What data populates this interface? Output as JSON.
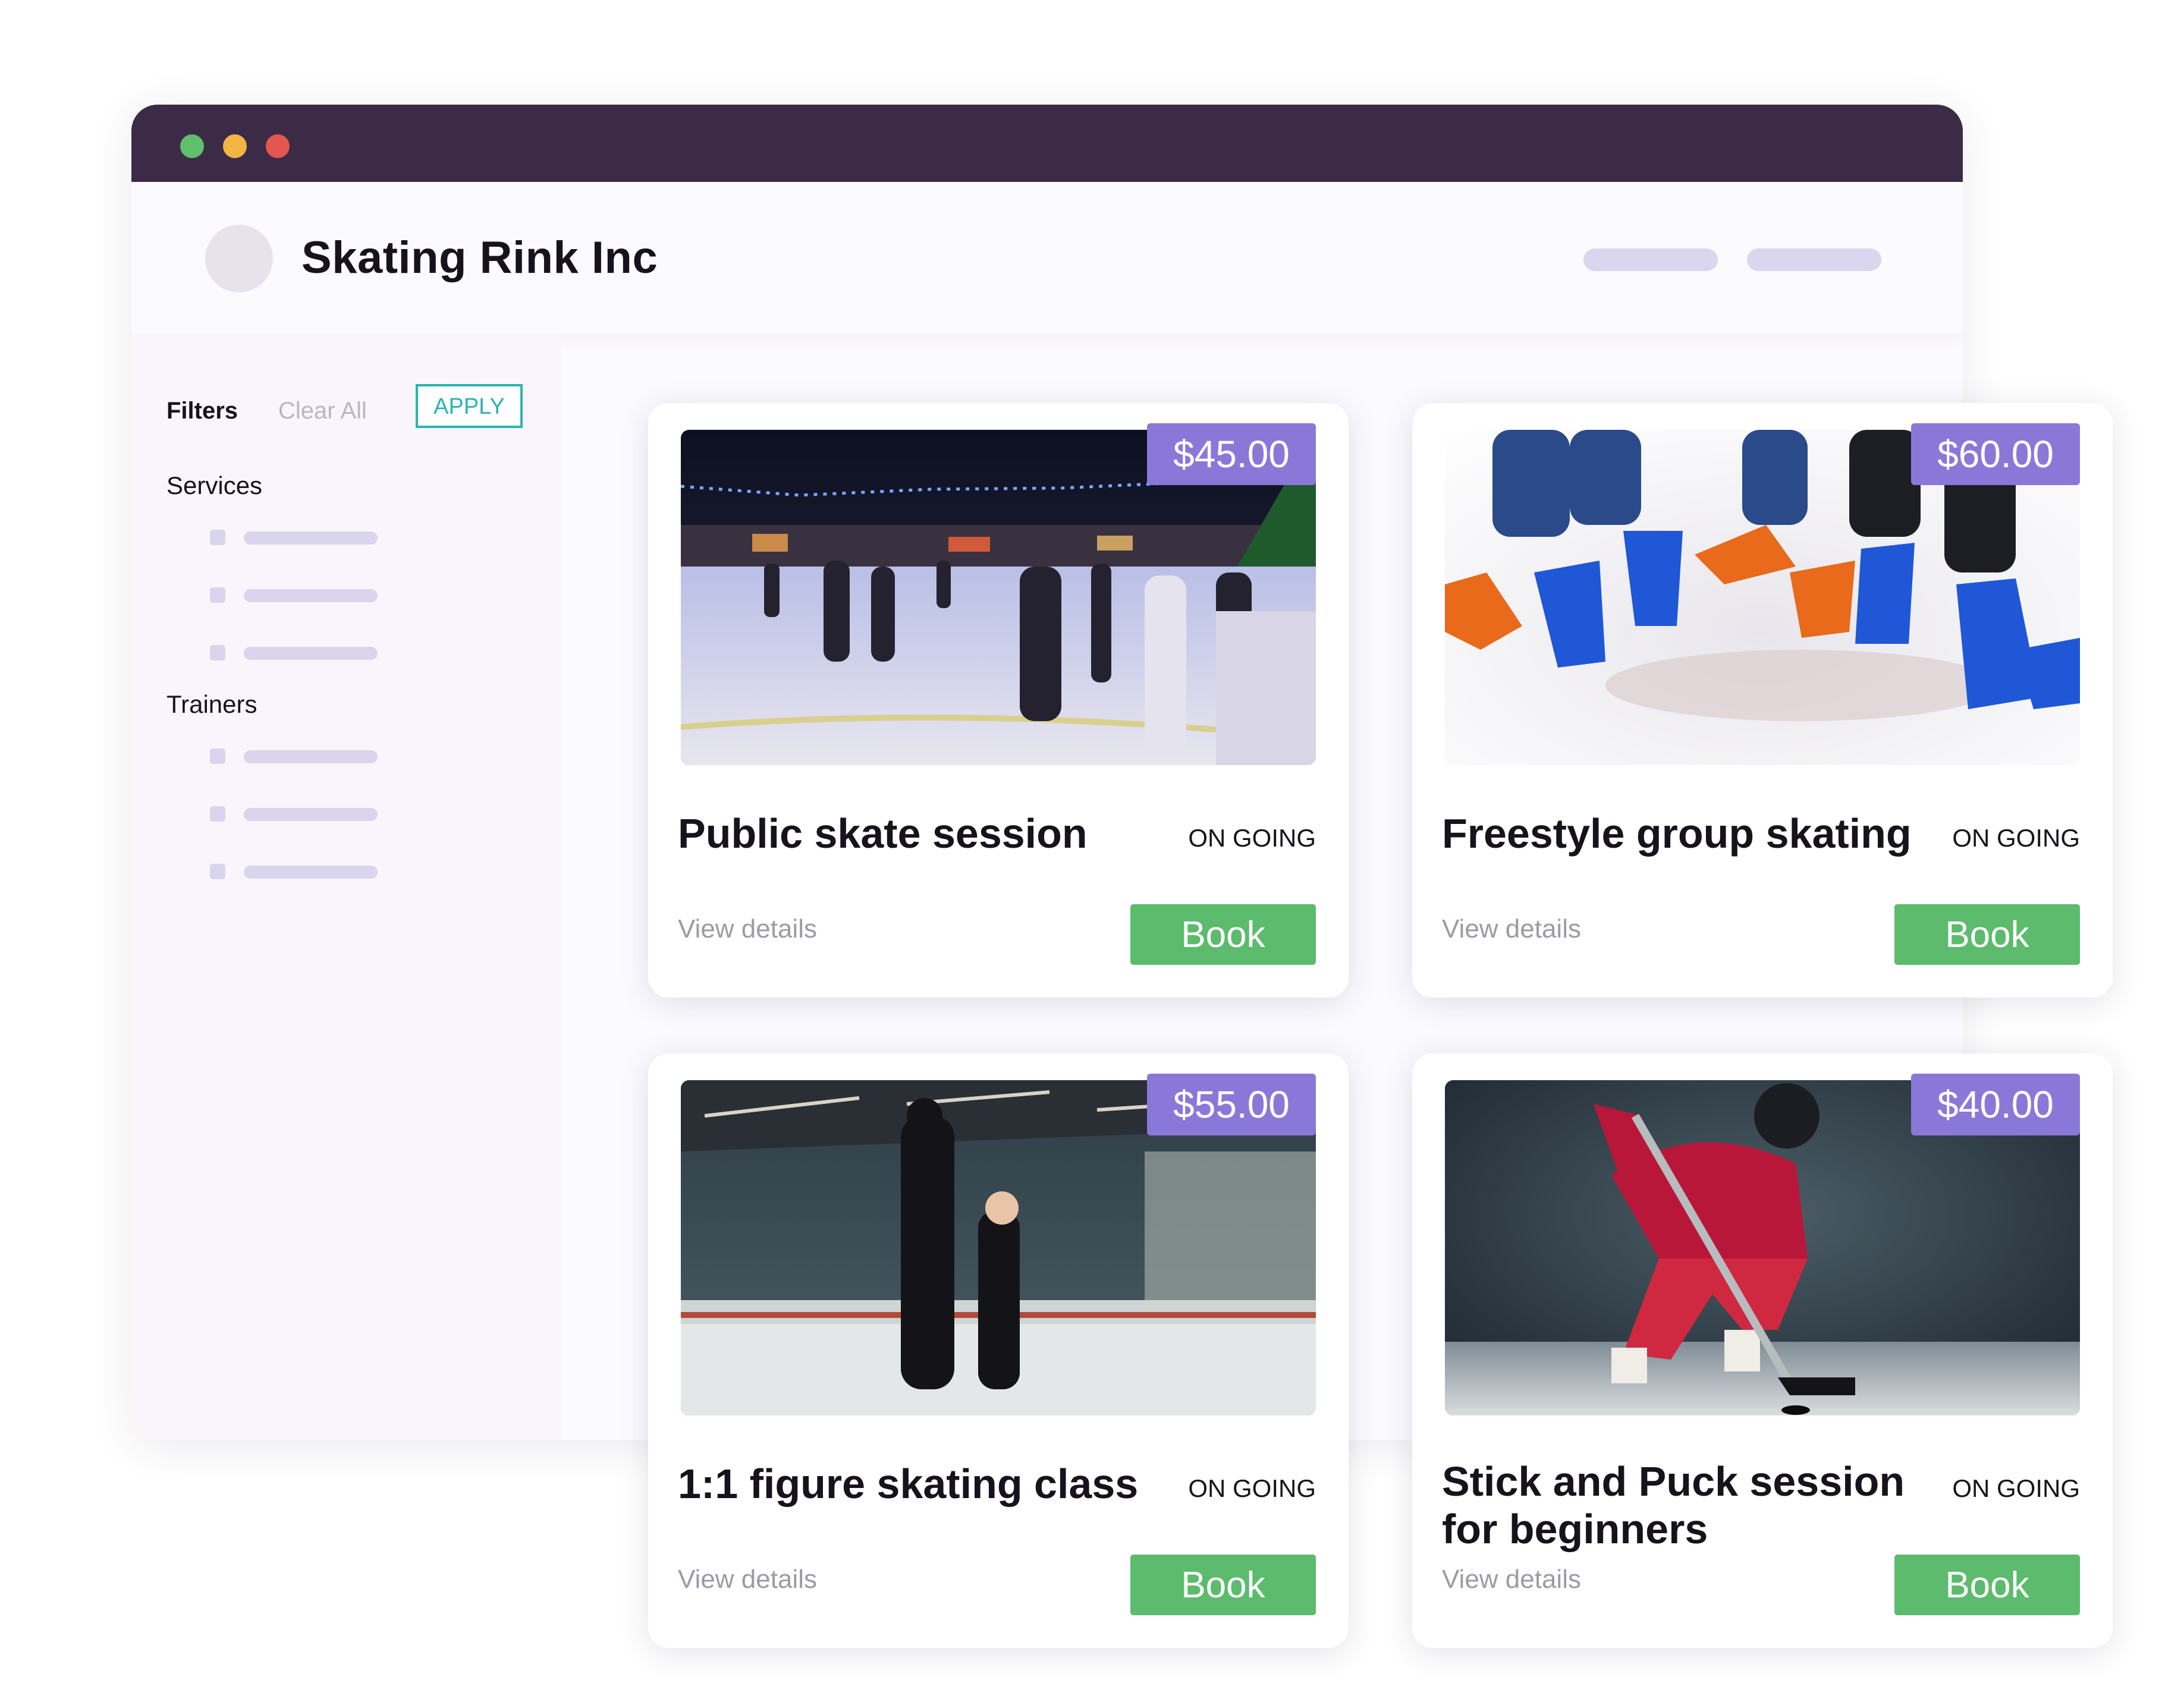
{
  "window": {
    "controls": [
      "close",
      "minimize",
      "maximize"
    ]
  },
  "header": {
    "brand": "Skating Rink Inc"
  },
  "sidebar": {
    "filters_label": "Filters",
    "clear_all_label": "Clear All",
    "apply_label": "APPLY",
    "sections": [
      {
        "label": "Services"
      },
      {
        "label": "Trainers"
      }
    ]
  },
  "cards": [
    {
      "title": "Public skate session",
      "price": "$45.00",
      "status": "ON GOING",
      "details_label": "View details",
      "book_label": "Book"
    },
    {
      "title": "Freestyle group skating",
      "price": "$60.00",
      "status": "ON GOING",
      "details_label": "View details",
      "book_label": "Book"
    },
    {
      "title": "1:1 figure skating class",
      "price": "$55.00",
      "status": "ON GOING",
      "details_label": "View details",
      "book_label": "Book"
    },
    {
      "title": "Stick and Puck session for beginners",
      "price": "$40.00",
      "status": "ON GOING",
      "details_label": "View details",
      "book_label": "Book"
    }
  ],
  "colors": {
    "titlebar": "#3c2b47",
    "accent_teal": "#2bb5ad",
    "price_badge": "#8a78d8",
    "book_button": "#5cbb6c"
  }
}
